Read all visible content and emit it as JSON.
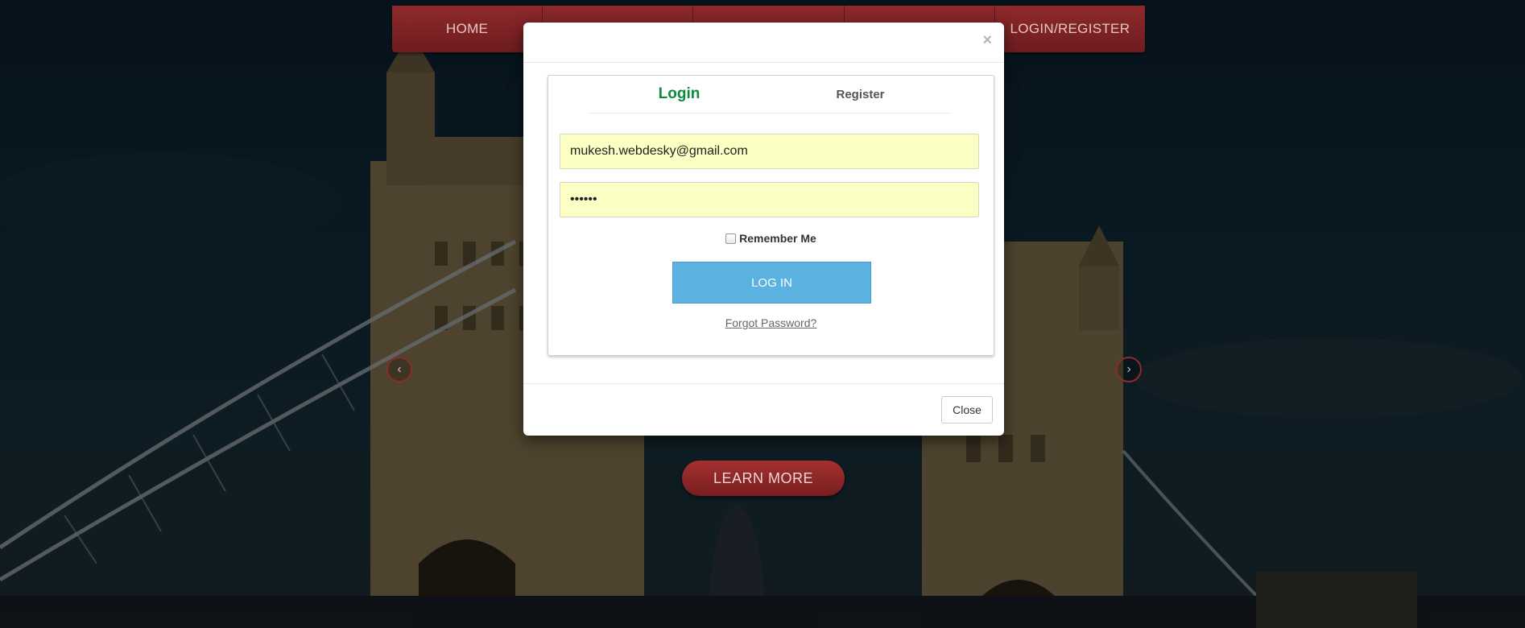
{
  "nav": {
    "items": [
      "HOME",
      "",
      "",
      "",
      "LOGIN/REGISTER"
    ]
  },
  "slider": {
    "prev_icon": "chevron-left-icon",
    "next_icon": "chevron-right-icon",
    "cta_label": "LEARN MORE"
  },
  "modal": {
    "close_x": "×",
    "tabs": {
      "login": "Login",
      "register": "Register"
    },
    "email_value": "mukesh.webdesky@gmail.com",
    "password_value": "••••••",
    "remember_label": "Remember Me",
    "login_button": "LOG IN",
    "forgot_link": "Forgot Password?",
    "close_button": "Close"
  },
  "colors": {
    "nav_bg": "#7c2124",
    "login_tab": "#0e8a3f",
    "login_button": "#5bb1e0",
    "field_bg": "#fbffc3"
  }
}
